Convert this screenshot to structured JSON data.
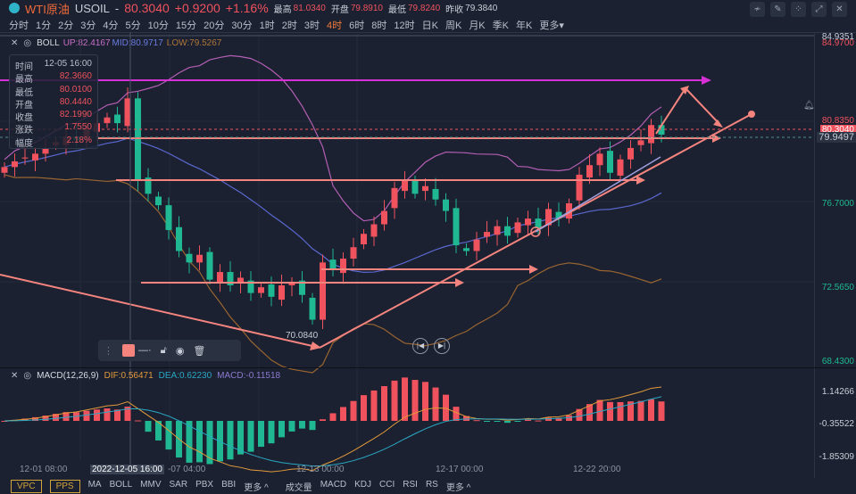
{
  "header": {
    "name": "WTI原油",
    "symbol": "USOIL",
    "price": "80.3040",
    "change": "+0.9200",
    "pct": "+1.16%",
    "high_label": "最高",
    "high": "81.0340",
    "open_label": "开盘",
    "open": "79.8910",
    "low_label": "最低",
    "low": "79.8240",
    "prev_label": "昨收",
    "prev": "79.3840"
  },
  "periods": [
    "分时",
    "1分",
    "2分",
    "3分",
    "4分",
    "5分",
    "10分",
    "15分",
    "20分",
    "30分",
    "1时",
    "2时",
    "3时",
    "4时",
    "6时",
    "8时",
    "12时",
    "日K",
    "周K",
    "月K",
    "季K",
    "年K",
    "更多▾"
  ],
  "active_period": "4时",
  "boll": {
    "name": "BOLL",
    "up": "UP:82.4167",
    "mid": "MID:80.9717",
    "low": "LOW:79.5267"
  },
  "macd": {
    "name": "MACD(12,26,9)",
    "dif": "DIF:0.56471",
    "dea": "DEA:0.62230",
    "macd": "MACD:-0.11518"
  },
  "tooltip": [
    [
      "时间",
      "12-05 16:00"
    ],
    [
      "最高",
      "82.3660"
    ],
    [
      "最低",
      "80.0100"
    ],
    [
      "开盘",
      "80.4440"
    ],
    [
      "收盘",
      "82.1990"
    ],
    [
      "涨跌",
      "1.7550"
    ],
    [
      "幅度",
      "2.18%"
    ]
  ],
  "price_axis": {
    "top1": "84.9351",
    "top2": "84.9700",
    "p1": "80.8350",
    "current": "80.3040",
    "alert": "79.9497",
    "p2": "76.7000",
    "p3": "72.5650",
    "p4": "68.4300"
  },
  "macd_axis": [
    "1.14266",
    "-0.35522",
    "-1.85309"
  ],
  "low_marker": "70.0840",
  "time_axis": [
    "12-01 08:00",
    "2022-12-05 16:00",
    "-07 04:00",
    "12-13 00:00",
    "12-17 00:00",
    "12-22 20:00"
  ],
  "bottom": {
    "boxes": [
      "VPC",
      "PPS"
    ],
    "main": [
      "MA",
      "BOLL",
      "MMV",
      "SAR",
      "PBX",
      "BBI",
      "更多 ^"
    ],
    "sub": [
      "成交量",
      "MACD",
      "KDJ",
      "CCI",
      "RSI",
      "RS",
      "更多 ^"
    ]
  },
  "colors": {
    "up": "#f0525e",
    "down": "#1fb892",
    "bg": "#1b2130",
    "drawing": "#f5847f",
    "magenta": "#d630d6"
  },
  "closes": [
    78.6,
    78.9,
    79.1,
    79.3,
    79.6,
    79.9,
    80.2,
    80.0,
    80.6,
    80.9,
    81.2,
    80.9,
    82.2,
    77.9,
    77.2,
    76.6,
    75.3,
    74.2,
    73.6,
    74.0,
    72.7,
    73.1,
    72.4,
    72.8,
    72.0,
    72.3,
    71.8,
    72.4,
    72.5,
    71.9,
    70.6,
    73.6,
    73.2,
    73.8,
    74.4,
    75.1,
    75.6,
    76.3,
    77.5,
    77.9,
    77.2,
    77.6,
    76.9,
    76.3,
    74.5,
    74.2,
    74.8,
    75.2,
    75.5,
    75.0,
    75.7,
    75.9,
    75.4,
    76.4,
    75.9,
    76.7,
    78.2,
    78.7,
    79.3,
    78.3,
    79.0,
    79.6,
    80.0,
    80.8,
    80.3
  ]
}
